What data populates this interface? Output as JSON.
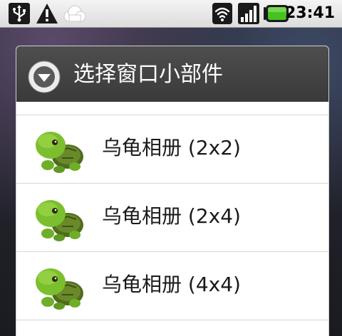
{
  "status_bar": {
    "time": "23:41",
    "icons": [
      "usb-icon",
      "warning-icon",
      "cloud-icon",
      "wifi-icon",
      "signal-icon",
      "battery-icon"
    ],
    "battery_color": "#44bb22"
  },
  "dialog": {
    "title": "选择窗口小部件",
    "title_icon": "dropdown-circle-icon",
    "items": [
      {
        "label": "乌龟相册 (2x2)",
        "icon": "turtle-icon"
      },
      {
        "label": "乌龟相册 (2x4)",
        "icon": "turtle-icon"
      },
      {
        "label": "乌龟相册 (4x4)",
        "icon": "turtle-icon"
      }
    ]
  },
  "colors": {
    "header_bg": "#444444",
    "list_bg": "#ffffff",
    "text": "#1a1a1a"
  }
}
